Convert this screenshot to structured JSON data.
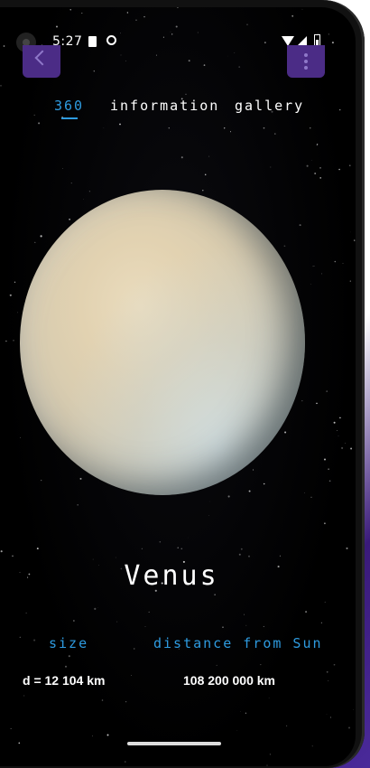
{
  "status_bar": {
    "time": "5:27",
    "icons": [
      "camera-icon",
      "sd-card-icon",
      "circle-icon",
      "wifi-icon",
      "signal-icon",
      "battery-icon"
    ]
  },
  "nav": {
    "back_icon": "chevron-left-icon",
    "menu_icon": "more-vertical-icon"
  },
  "tabs": [
    {
      "label": "360",
      "active": true
    },
    {
      "label": "information",
      "active": false
    },
    {
      "label": "gallery",
      "active": false
    }
  ],
  "planet": {
    "name": "Venus",
    "image": "venus-planet"
  },
  "stats": {
    "size_label": "size",
    "size_value": "d = 12 104 km",
    "distance_label": "distance from Sun",
    "distance_value": "108 200 000 km"
  },
  "colors": {
    "accent": "#2e9be0",
    "button_bg": "#4b2c86",
    "background": "#000000",
    "text": "#ffffff"
  }
}
